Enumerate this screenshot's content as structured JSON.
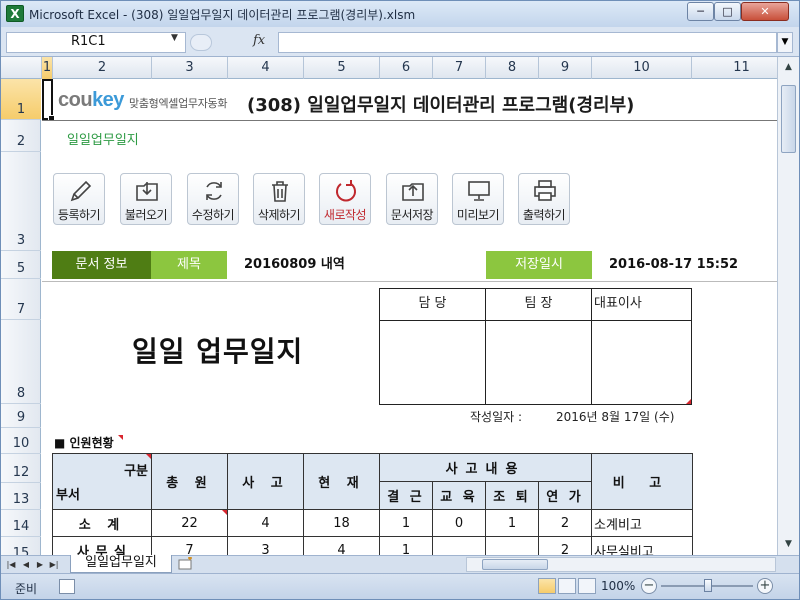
{
  "window": {
    "title": "Microsoft Excel - (308) 일일업무일지 데이터관리 프로그램(경리부).xlsm",
    "app_icon_letter": "X",
    "min_glyph": "─",
    "max_glyph": "□",
    "close_glyph": "✕"
  },
  "formula_bar": {
    "name_box": "R1C1",
    "fx": "fx",
    "formula": ""
  },
  "columns": [
    "1",
    "2",
    "3",
    "4",
    "5",
    "6",
    "7",
    "8",
    "9",
    "10",
    "11"
  ],
  "rows": [
    "1",
    "2",
    "3",
    "5",
    "7",
    "8",
    "9",
    "10",
    "12",
    "13",
    "14",
    "15"
  ],
  "header": {
    "logo_grey": "cou",
    "logo_blue": "key",
    "slogan": "맞춤형엑셀업무자동화",
    "title": "(308) 일일업무일지 데이터관리 프로그램(경리부)",
    "subtitle": "일일업무일지"
  },
  "toolbar": [
    {
      "label": "등록하기",
      "icon": "pencil-icon"
    },
    {
      "label": "불러오기",
      "icon": "import-folder-icon"
    },
    {
      "label": "수정하기",
      "icon": "refresh-arrows-icon"
    },
    {
      "label": "삭제하기",
      "icon": "trash-icon"
    },
    {
      "label": "새로작성",
      "icon": "new-circle-arrow-icon"
    },
    {
      "label": "문서저장",
      "icon": "save-folder-icon"
    },
    {
      "label": "미리보기",
      "icon": "monitor-icon"
    },
    {
      "label": "출력하기",
      "icon": "printer-icon"
    }
  ],
  "info": {
    "section_label": "문서 정보",
    "title_label": "제목",
    "title_value": "20160809 내역",
    "saved_label": "저장일시",
    "saved_value": "2016-08-17 15:52"
  },
  "document": {
    "big_title": "일일 업무일지",
    "sign": [
      "담 당",
      "팀 장",
      "대표이사"
    ],
    "write_date_label": "작성일자 :",
    "write_date_value": "2016년 8월 17일 (수)",
    "section": "■ 인원현황"
  },
  "personnel_table": {
    "header_corner_top": "구분",
    "header_corner_bottom": "부서",
    "col_total": "총 원",
    "col_accident": "사 고",
    "col_present": "현 재",
    "col_reason_group": "사고내용",
    "col_reasons": [
      "결 근",
      "교 육",
      "조 퇴",
      "연 가"
    ],
    "col_note": "비 고",
    "rows": [
      {
        "dept": "소 계",
        "total": "22",
        "accident": "4",
        "present": "18",
        "absent": "1",
        "edu": "0",
        "early": "1",
        "leave": "2",
        "note": "소계비고"
      },
      {
        "dept": "사 무 실",
        "total": "7",
        "accident": "3",
        "present": "4",
        "absent": "1",
        "edu": "",
        "early": "",
        "leave": "2",
        "note": "사무실비고"
      }
    ]
  },
  "sheet_tabs": [
    "일일업무일지"
  ],
  "status": {
    "ready": "준비",
    "zoom": "100%",
    "zoom_minus": "−",
    "zoom_plus": "+"
  },
  "colors": {
    "green_dark": "#4f7d14",
    "green_light": "#8cc63f",
    "accent_red": "#c0282e"
  }
}
